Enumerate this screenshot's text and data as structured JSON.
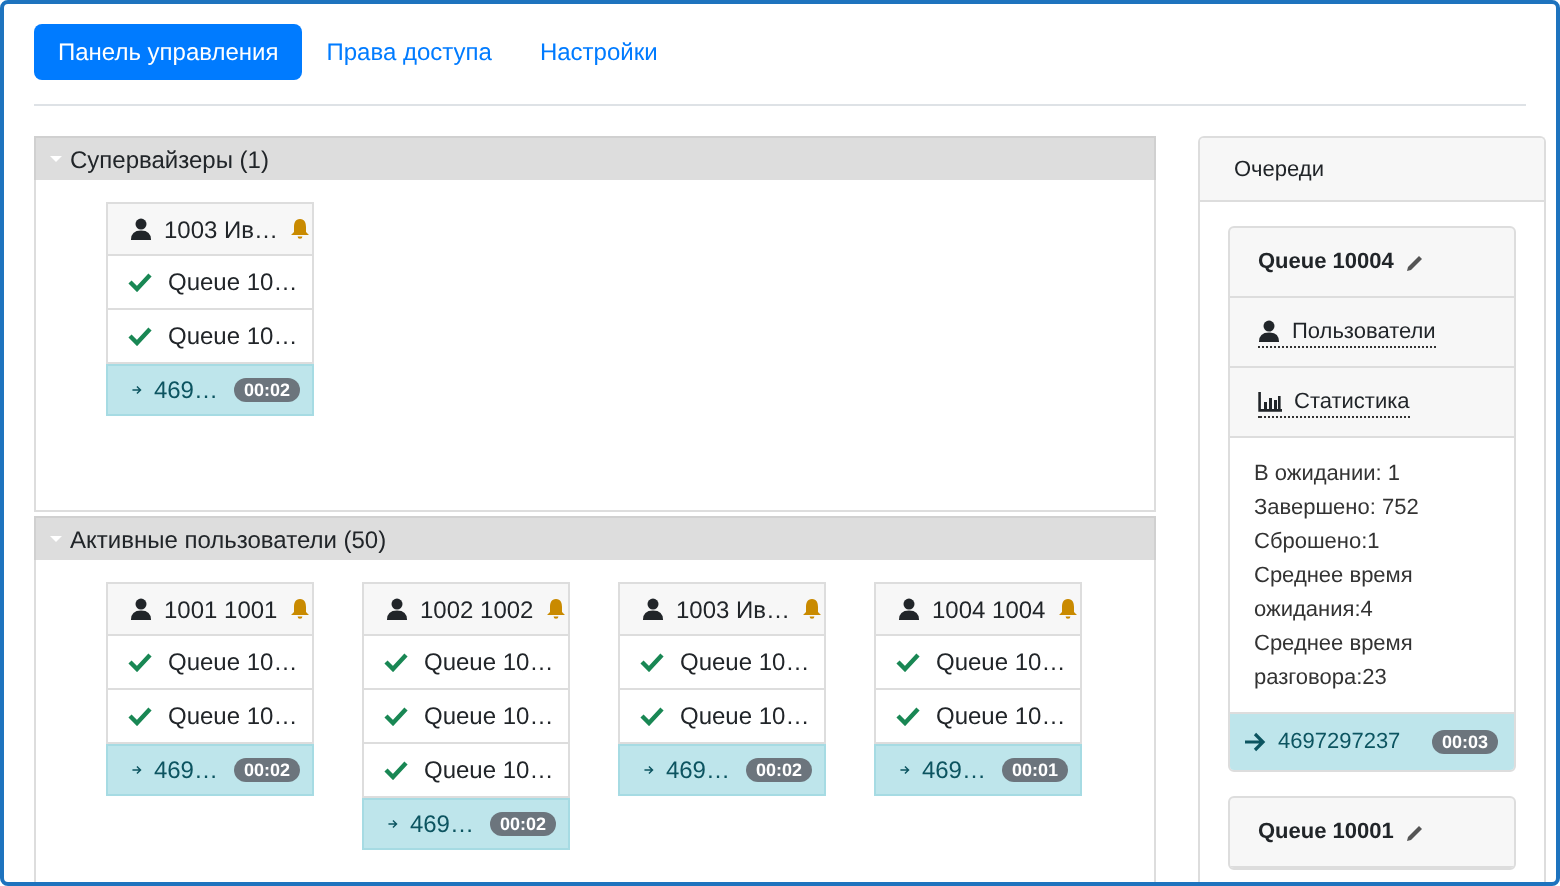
{
  "tabs": [
    {
      "label": "Панель управления",
      "selected": true
    },
    {
      "label": "Права доступа",
      "selected": false
    },
    {
      "label": "Настройки",
      "selected": false
    }
  ],
  "sections": [
    {
      "title": "Супервайзеры (1)",
      "cards": [
        {
          "name": "1003 Ив…",
          "queues": [
            "Queue 10…",
            "Queue 10…"
          ],
          "call": {
            "number": "469…",
            "timer": "00:02"
          }
        }
      ]
    },
    {
      "title": "Активные пользователи (50)",
      "cards": [
        {
          "name": "1001 1001",
          "queues": [
            "Queue 10…",
            "Queue 10…"
          ],
          "call": {
            "number": "469…",
            "timer": "00:02"
          }
        },
        {
          "name": "1002 1002",
          "queues": [
            "Queue 10…",
            "Queue 10…",
            "Queue 10…"
          ],
          "call": {
            "number": "469…",
            "timer": "00:02"
          }
        },
        {
          "name": "1003 Ив…",
          "queues": [
            "Queue 10…",
            "Queue 10…"
          ],
          "call": {
            "number": "469…",
            "timer": "00:02"
          }
        },
        {
          "name": "1004 1004",
          "queues": [
            "Queue 10…",
            "Queue 10…"
          ],
          "call": {
            "number": "469…",
            "timer": "00:01"
          }
        }
      ]
    }
  ],
  "queues_panel": {
    "title": "Очереди",
    "queues": [
      {
        "name": "Queue 10004",
        "users_link": "Пользователи",
        "stats_link": "Статистика",
        "stats": [
          "В ожидании: 1",
          "Завершено: 752",
          "Сброшено:1",
          "Среднее время ожидания:4",
          "Среднее время разговора:23"
        ],
        "call": {
          "number": "4697297237",
          "timer": "00:03"
        }
      },
      {
        "name": "Queue 10001"
      }
    ]
  }
}
